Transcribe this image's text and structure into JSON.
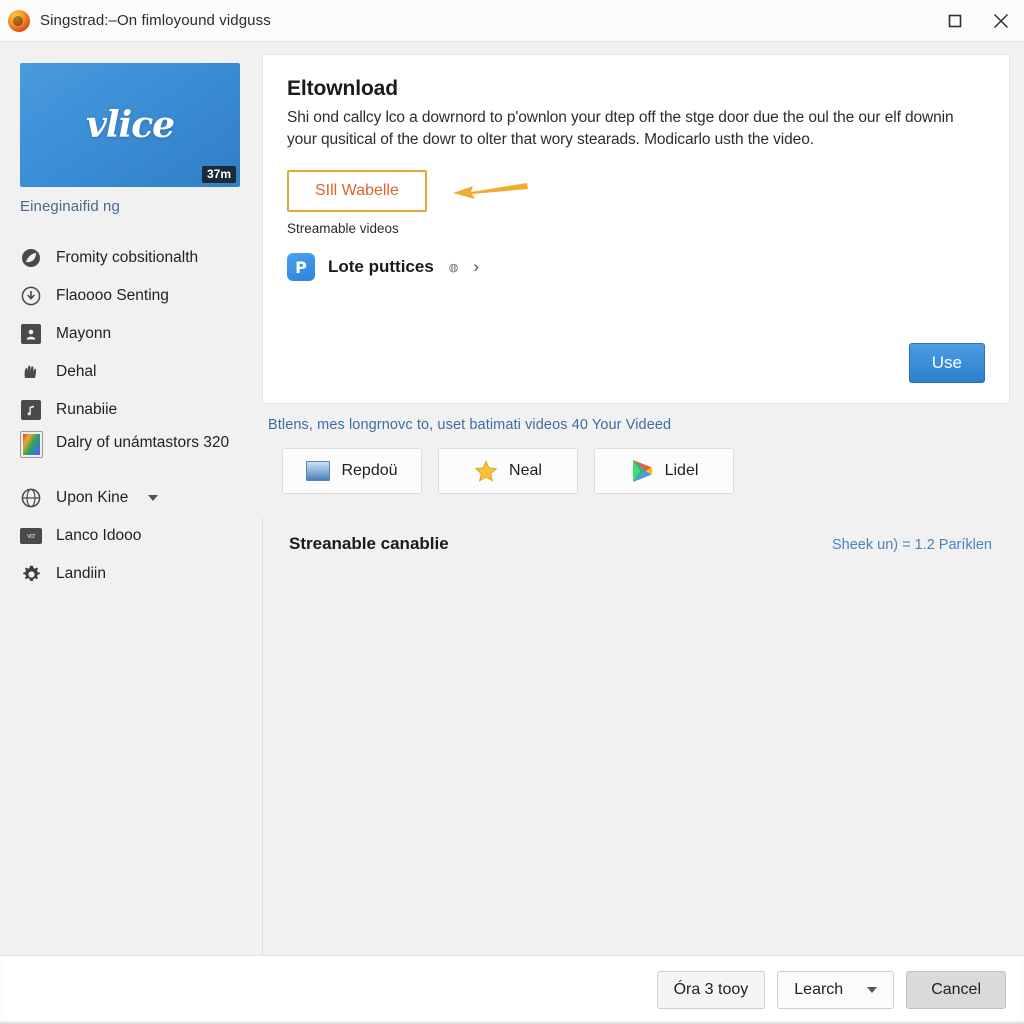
{
  "window": {
    "title": "Singstrad:–On fimloyound vidguss",
    "app_icon": "firefox-icon",
    "maximize_label": "maximize-icon",
    "close_label": "close-icon"
  },
  "sidebar": {
    "thumbnail": {
      "logo_text": "vlice",
      "duration": "37m",
      "caption": "Eineginaifid ng"
    },
    "items": [
      {
        "label": "Fromity cobsitionalth",
        "icon": "leaf-circle-icon"
      },
      {
        "label": "Flaoooo Senting",
        "icon": "download-circle-icon"
      },
      {
        "label": "Mayonn",
        "icon": "person-frame-icon"
      },
      {
        "label": "Dehal",
        "icon": "hand-icon"
      },
      {
        "label": "Runabiie",
        "icon": "music-note-icon"
      },
      {
        "label": "Dalry of unámtastors 320",
        "icon": "color-image-icon"
      },
      {
        "label": "Upon Kine",
        "icon": "globe-icon",
        "caret": true
      },
      {
        "label": "Lanco Idooo",
        "icon": "card-icon",
        "icon_text": "vcr"
      },
      {
        "label": "Landiin",
        "icon": "gear-icon"
      }
    ]
  },
  "card": {
    "title": "Eltownload",
    "body": "Shi ond callcy lco a dowrnord to p'ownlon your dtep off the stge door due the oul the our elf downin your qusitical of the dowr to olter that wory stearads. Modicarlo usth the video.",
    "cta_label": "SIll Wabelle",
    "cta_sub": "Streamable videos",
    "app_link": {
      "tile_glyph": "P",
      "label": "Lote puttices",
      "mini_icon": "small-badge-icon",
      "chevron": "›"
    },
    "use_label": "Use"
  },
  "under_link": "Btlens, mes longrnovc to, uset batimati videos 40 Your Videed",
  "option_buttons": [
    {
      "label": "Repdoü",
      "icon": "screen-image-icon"
    },
    {
      "label": "Neal",
      "icon": "star-icon"
    },
    {
      "label": "Lidel",
      "icon": "play-store-icon"
    }
  ],
  "lower_section": {
    "title": "Streanable canablie",
    "link": "Sheek un) = 1.2 Paríklen"
  },
  "footer": {
    "buttons": [
      {
        "label": "Óra 3 tooy",
        "style": "plain"
      },
      {
        "label": "Learch",
        "style": "dropdown"
      },
      {
        "label": "Cancel",
        "style": "dark"
      }
    ]
  },
  "colors": {
    "accent_blue": "#2e80cd",
    "cta_orange": "#e8a33d",
    "cta_text": "#e2622a",
    "link_blue": "#3c6ea5"
  }
}
